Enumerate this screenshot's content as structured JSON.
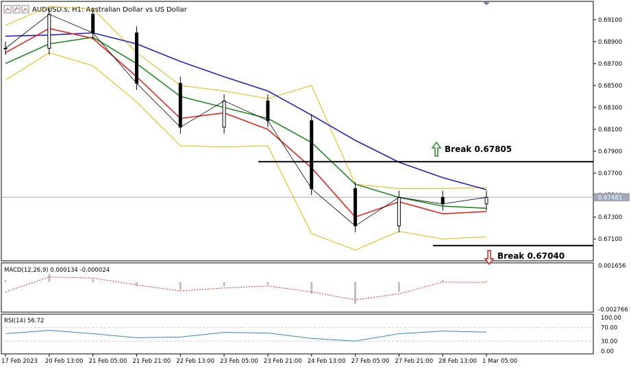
{
  "window": {
    "symbol_title": "AUDUSD.s, H1:  Australian Dollar vs US Dollar"
  },
  "colors": {
    "price": "#000000",
    "ma_blue": "#1f1fd1",
    "ma_green": "#1f8a1f",
    "ma_red": "#e8261e",
    "bollinger": "#e6b800",
    "break_up_arrow": "#2e8b2e",
    "break_down_arrow": "#d42020",
    "macd_hist": "#c0c0c0",
    "macd_signal": "#e8261e",
    "rsi_line": "#2f86c8"
  },
  "annotations": {
    "break_up": "Break 0.67805",
    "break_down": "Break 0.67040"
  },
  "chart_data": [
    {
      "type": "line",
      "name": "price-panel",
      "title": "AUDUSD.s, H1:  Australian Dollar vs US Dollar",
      "ylim": [
        0.6692,
        0.6923
      ],
      "y_ticks": [
        "0.69100",
        "0.68900",
        "0.68700",
        "0.68500",
        "0.68300",
        "0.68100",
        "0.67900",
        "0.67700",
        "0.67500",
        "0.67300",
        "0.67100"
      ],
      "current_price": "0.67481",
      "x": [
        "17 Feb 2023",
        "20 Feb 13:00",
        "21 Feb 05:00",
        "21 Feb 21:00",
        "22 Feb 13:00",
        "23 Feb 05:00",
        "23 Feb 21:00",
        "24 Feb 13:00",
        "27 Feb 05:00",
        "27 Feb 21:00",
        "28 Feb 13:00",
        "1 Mar 05:00"
      ],
      "series": [
        {
          "key": "price",
          "values": [
            0.6884,
            0.6915,
            0.6898,
            0.6852,
            0.6812,
            0.6836,
            0.6818,
            0.6756,
            0.6722,
            0.6748,
            0.6742,
            0.6748
          ]
        },
        {
          "key": "ma_blue",
          "values": [
            0.6895,
            0.6896,
            0.6898,
            0.6888,
            0.6872,
            0.6858,
            0.6845,
            0.6823,
            0.68,
            0.678,
            0.6766,
            0.6755
          ]
        },
        {
          "key": "ma_green",
          "values": [
            0.687,
            0.6888,
            0.6894,
            0.687,
            0.684,
            0.683,
            0.682,
            0.6798,
            0.676,
            0.6748,
            0.674,
            0.6738
          ]
        },
        {
          "key": "ma_red",
          "values": [
            0.688,
            0.6902,
            0.6893,
            0.6858,
            0.682,
            0.6825,
            0.681,
            0.6775,
            0.673,
            0.6744,
            0.6733,
            0.6735
          ]
        },
        {
          "key": "bb_upper",
          "values": [
            0.6905,
            0.6922,
            0.692,
            0.688,
            0.685,
            0.6845,
            0.6838,
            0.685,
            0.676,
            0.6756,
            0.6756,
            0.6757
          ]
        },
        {
          "key": "bb_lower",
          "values": [
            0.6855,
            0.688,
            0.6868,
            0.6835,
            0.6795,
            0.6794,
            0.6795,
            0.6715,
            0.67,
            0.6717,
            0.671,
            0.6712
          ]
        }
      ],
      "levels": {
        "break_up": 0.67805,
        "break_down": 0.6704
      }
    },
    {
      "type": "bar",
      "name": "macd-panel",
      "title": "MACD(12,26,9) 0.000134 -0.000024",
      "y_ticks": [
        "0.001656",
        "-0.002766"
      ],
      "ylim": [
        -0.002766,
        0.001656
      ],
      "x": [
        "17 Feb 2023",
        "20 Feb 13:00",
        "21 Feb 05:00",
        "21 Feb 21:00",
        "22 Feb 13:00",
        "23 Feb 05:00",
        "23 Feb 21:00",
        "24 Feb 13:00",
        "27 Feb 05:00",
        "27 Feb 21:00",
        "28 Feb 13:00",
        "1 Mar 05:00"
      ],
      "series": [
        {
          "key": "histogram",
          "values": [
            0.0002,
            0.0008,
            0.0003,
            -0.0004,
            -0.0008,
            -0.0004,
            -0.0003,
            -0.0012,
            -0.0022,
            -0.001,
            0.0002,
            0.0001
          ]
        },
        {
          "key": "signal",
          "values": [
            -0.001,
            0.0005,
            0.0004,
            -0.0003,
            -0.0009,
            -0.0006,
            -0.0004,
            -0.001,
            -0.0018,
            -0.0012,
            0.0,
            -2e-05
          ]
        }
      ]
    },
    {
      "type": "line",
      "name": "rsi-panel",
      "title": "RSI(14) 56.72",
      "y_ticks": [
        "100.00",
        "70.00",
        "30.00",
        "0.00"
      ],
      "ylim": [
        0,
        100
      ],
      "levels": [
        70,
        30
      ],
      "x": [
        "17 Feb 2023",
        "20 Feb 13:00",
        "21 Feb 05:00",
        "21 Feb 21:00",
        "22 Feb 13:00",
        "23 Feb 05:00",
        "23 Feb 21:00",
        "24 Feb 13:00",
        "27 Feb 05:00",
        "27 Feb 21:00",
        "28 Feb 13:00",
        "1 Mar 05:00"
      ],
      "series": [
        {
          "key": "rsi",
          "values": [
            52,
            62,
            52,
            40,
            42,
            56,
            54,
            38,
            30,
            52,
            60,
            56.72
          ]
        }
      ]
    }
  ]
}
